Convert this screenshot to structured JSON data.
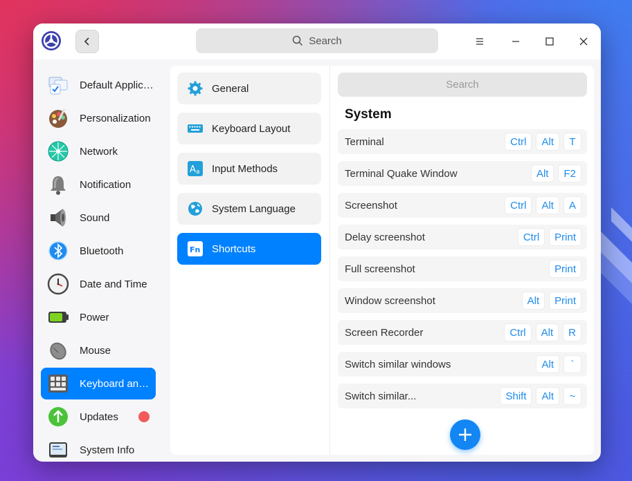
{
  "titlebar": {
    "search_placeholder": "Search",
    "icons": {
      "logo": "settings-logo-icon",
      "back": "chevron-left-icon",
      "search": "search-icon",
      "menu": "menu-icon",
      "minimize": "minimize-icon",
      "maximize": "maximize-icon",
      "close": "close-icon"
    }
  },
  "sidebar": {
    "items": [
      {
        "label": "Default Applications",
        "icon": "default-applications-icon"
      },
      {
        "label": "Personalization",
        "icon": "personalization-icon"
      },
      {
        "label": "Network",
        "icon": "network-icon"
      },
      {
        "label": "Notification",
        "icon": "notification-bell-icon"
      },
      {
        "label": "Sound",
        "icon": "speaker-icon"
      },
      {
        "label": "Bluetooth",
        "icon": "bluetooth-icon"
      },
      {
        "label": "Date and Time",
        "icon": "clock-icon"
      },
      {
        "label": "Power",
        "icon": "battery-icon"
      },
      {
        "label": "Mouse",
        "icon": "mouse-icon"
      },
      {
        "label": "Keyboard and Language",
        "icon": "keyboard-icon",
        "active": true
      },
      {
        "label": "Updates",
        "icon": "update-arrow-icon",
        "badge": "red-dot"
      },
      {
        "label": "System Info",
        "icon": "system-info-icon"
      }
    ]
  },
  "categories": [
    {
      "label": "General",
      "icon": "gear-icon"
    },
    {
      "label": "Keyboard Layout",
      "icon": "keyboard-layout-icon"
    },
    {
      "label": "Input Methods",
      "icon": "input-methods-icon"
    },
    {
      "label": "System Language",
      "icon": "globe-icon"
    },
    {
      "label": "Shortcuts",
      "icon": "fn-icon",
      "active": true
    }
  ],
  "shortcuts": {
    "search_placeholder": "Search",
    "section_title": "System",
    "rows": [
      {
        "name": "Terminal",
        "keys": [
          "Ctrl",
          "Alt",
          "T"
        ]
      },
      {
        "name": "Terminal Quake Window",
        "keys": [
          "Alt",
          "F2"
        ]
      },
      {
        "name": "Screenshot",
        "keys": [
          "Ctrl",
          "Alt",
          "A"
        ]
      },
      {
        "name": "Delay screenshot",
        "keys": [
          "Ctrl",
          "Print"
        ]
      },
      {
        "name": "Full screenshot",
        "keys": [
          "Print"
        ]
      },
      {
        "name": "Window screenshot",
        "keys": [
          "Alt",
          "Print"
        ]
      },
      {
        "name": "Screen Recorder",
        "keys": [
          "Ctrl",
          "Alt",
          "R"
        ]
      },
      {
        "name": "Switch similar windows",
        "keys": [
          "Alt",
          "`"
        ]
      },
      {
        "name": "Switch similar...",
        "keys": [
          "Shift",
          "Alt",
          "~"
        ]
      }
    ],
    "add_button_icon": "plus-icon"
  },
  "colors": {
    "accent": "#0081ff",
    "key_text": "#1e8bea",
    "badge": "#f35b5b"
  }
}
